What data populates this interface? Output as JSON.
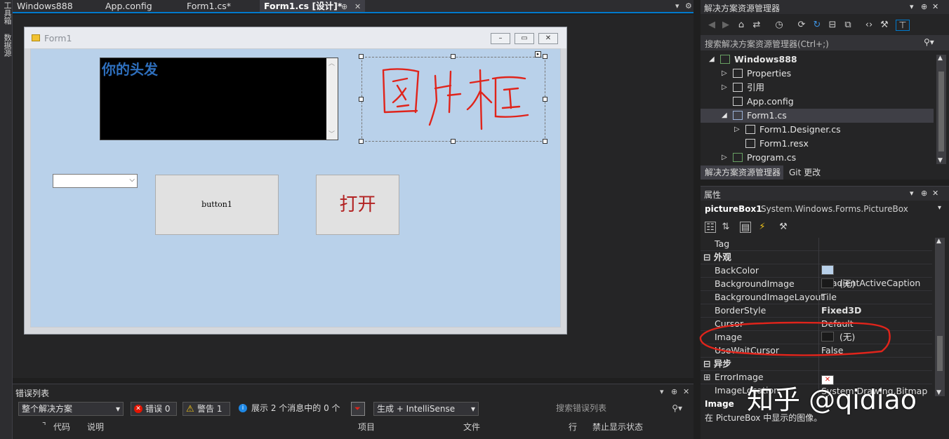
{
  "left_strip": {
    "items": [
      "工具箱",
      "数据源"
    ]
  },
  "tabs": [
    {
      "label": "Windows888"
    },
    {
      "label": "App.config"
    },
    {
      "label": "Form1.cs*"
    },
    {
      "label": "Form1.cs [设计]*"
    }
  ],
  "tab_controls": {
    "pin": "⊕",
    "close": "✕",
    "dropdown": "▾",
    "settings": "⚙"
  },
  "form": {
    "title": "Form1",
    "textbox_text": "你的头发",
    "picturebox_text": "图片框",
    "button1_label": "button1",
    "open_button_label": "打开"
  },
  "error_list": {
    "title": "错误列表",
    "scope": "整个解决方案",
    "errors": "错误 0",
    "warnings": "警告 1",
    "messages": "展示 2 个消息中的 0 个",
    "build_filter": "生成 + IntelliSense",
    "search_placeholder": "搜索错误列表",
    "columns": [
      "代码",
      "说明",
      "项目",
      "文件",
      "行",
      "禁止显示状态"
    ]
  },
  "solution_explorer": {
    "title": "解决方案资源管理器",
    "search_placeholder": "搜索解决方案资源管理器(Ctrl+;)",
    "tree": [
      {
        "label": "Windows888",
        "indent": 1,
        "expander": "◢",
        "icon": "csharp-project-icon"
      },
      {
        "label": "Properties",
        "indent": 2,
        "expander": "▷",
        "icon": "wrench-icon"
      },
      {
        "label": "引用",
        "indent": 2,
        "expander": "▷",
        "icon": "references-icon"
      },
      {
        "label": "App.config",
        "indent": 2,
        "expander": "",
        "icon": "config-file-icon"
      },
      {
        "label": "Form1.cs",
        "indent": 2,
        "expander": "◢",
        "icon": "form-icon",
        "selected": true
      },
      {
        "label": "Form1.Designer.cs",
        "indent": 3,
        "expander": "▷",
        "icon": "file-icon"
      },
      {
        "label": "Form1.resx",
        "indent": 3,
        "expander": "",
        "icon": "file-icon"
      },
      {
        "label": "Program.cs",
        "indent": 2,
        "expander": "▷",
        "icon": "csharp-file-icon"
      }
    ],
    "bottom_tabs": [
      "解决方案资源管理器",
      "Git 更改"
    ]
  },
  "properties": {
    "title": "属性",
    "object_name": "pictureBox1",
    "object_type": "System.Windows.Forms.PictureBox",
    "rows": [
      {
        "kind": "prop",
        "name": "Tag",
        "value": ""
      },
      {
        "kind": "cat",
        "name": "外观"
      },
      {
        "kind": "prop",
        "name": "BackColor",
        "value": "GradientActiveCaption",
        "swatch": "#b9d1ea"
      },
      {
        "kind": "prop",
        "name": "BackgroundImage",
        "value": "(无)",
        "swatch": "#1a1a1a"
      },
      {
        "kind": "prop",
        "name": "BackgroundImageLayout",
        "value": "Tile"
      },
      {
        "kind": "prop",
        "name": "BorderStyle",
        "value": "Fixed3D",
        "bold": true
      },
      {
        "kind": "prop",
        "name": "Cursor",
        "value": "Default"
      },
      {
        "kind": "prop",
        "name": "Image",
        "value": "(无)",
        "swatch": "#1a1a1a"
      },
      {
        "kind": "prop",
        "name": "UseWaitCursor",
        "value": "False"
      },
      {
        "kind": "cat",
        "name": "异步"
      },
      {
        "kind": "prop",
        "name": "ErrorImage",
        "value": "System.Drawing.Bitmap",
        "swatch": "#ffffff",
        "expander": "⊞"
      },
      {
        "kind": "prop",
        "name": "ImageLocation",
        "value": ""
      }
    ],
    "description_title": "Image",
    "description_text": "在 PictureBox 中显示的图像。"
  },
  "watermark": "知乎 @qidiao",
  "colors": {
    "accent": "#007acc",
    "form_back": "#b9d1ea",
    "annotation_red": "#e0241b",
    "textbox_text": "#2e6fbd"
  }
}
